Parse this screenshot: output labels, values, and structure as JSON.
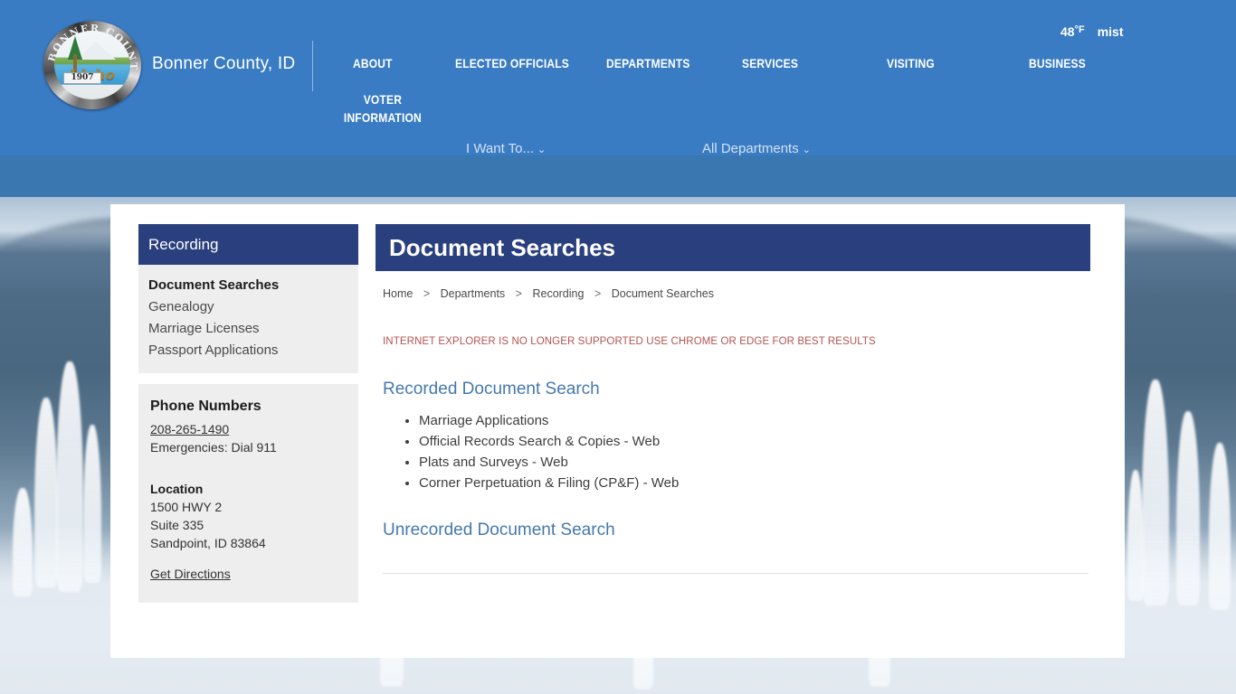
{
  "header": {
    "site_name": "Bonner County, ID",
    "logo": {
      "ring_text": "BONNER COUNTY",
      "state_name": "Idaho",
      "year": "1907"
    },
    "weather": {
      "temperature": "48",
      "degree_unit": "°F",
      "condition": "mist"
    },
    "nav_items": [
      {
        "label": "ABOUT"
      },
      {
        "label": "ELECTED OFFICIALS"
      },
      {
        "label": "DEPARTMENTS"
      },
      {
        "label": "SERVICES"
      },
      {
        "label": "VISITING"
      },
      {
        "label": "BUSINESS"
      },
      {
        "label": "VOTER INFORMATION"
      }
    ],
    "sub_nav": [
      {
        "label": "I Want To...",
        "caret": "⌄"
      },
      {
        "label": "All Departments",
        "caret": "⌄"
      }
    ]
  },
  "sidebar": {
    "title": "Recording",
    "items": [
      {
        "label": "Document Searches",
        "active": true
      },
      {
        "label": "Genealogy",
        "active": false
      },
      {
        "label": "Marriage Licenses",
        "active": false
      },
      {
        "label": "Passport Applications",
        "active": false
      }
    ],
    "info_box": {
      "phone_heading": "Phone Numbers",
      "phone_number": "208-265-1490",
      "emergency_line": "Emergencies: Dial 911",
      "location_heading": "Location",
      "address_line1": "1500 HWY 2",
      "address_line2": "Suite 335",
      "address_line3": "Sandpoint, ID 83864",
      "directions_link": "Get Directions"
    }
  },
  "main": {
    "page_title": "Document Searches",
    "breadcrumb": [
      {
        "label": "Home"
      },
      {
        "label": "Departments"
      },
      {
        "label": "Recording"
      },
      {
        "label": "Document Searches"
      }
    ],
    "breadcrumb_separator": ">",
    "notice": "INTERNET EXPLORER IS NO LONGER SUPPORTED USE CHROME OR EDGE FOR BEST RESULTS",
    "section_recorded": {
      "heading": "Recorded Document Search",
      "links": [
        {
          "label": "Marriage Applications"
        },
        {
          "label": "Official Records Search & Copies - Web"
        },
        {
          "label": "Plats and Surveys - Web"
        },
        {
          "label": "Corner Perpetuation & Filing (CP&F) - Web"
        }
      ]
    },
    "section_unrecorded": {
      "heading": "Unrecorded Document Search"
    }
  },
  "colors": {
    "header_blue": "#3a7cc4",
    "header_band2": "#3a76b0",
    "navy": "#2a3f7d",
    "link_blue": "#4579ad",
    "notice_red": "#b5524f",
    "sidebar_gray": "#eeeeee"
  }
}
